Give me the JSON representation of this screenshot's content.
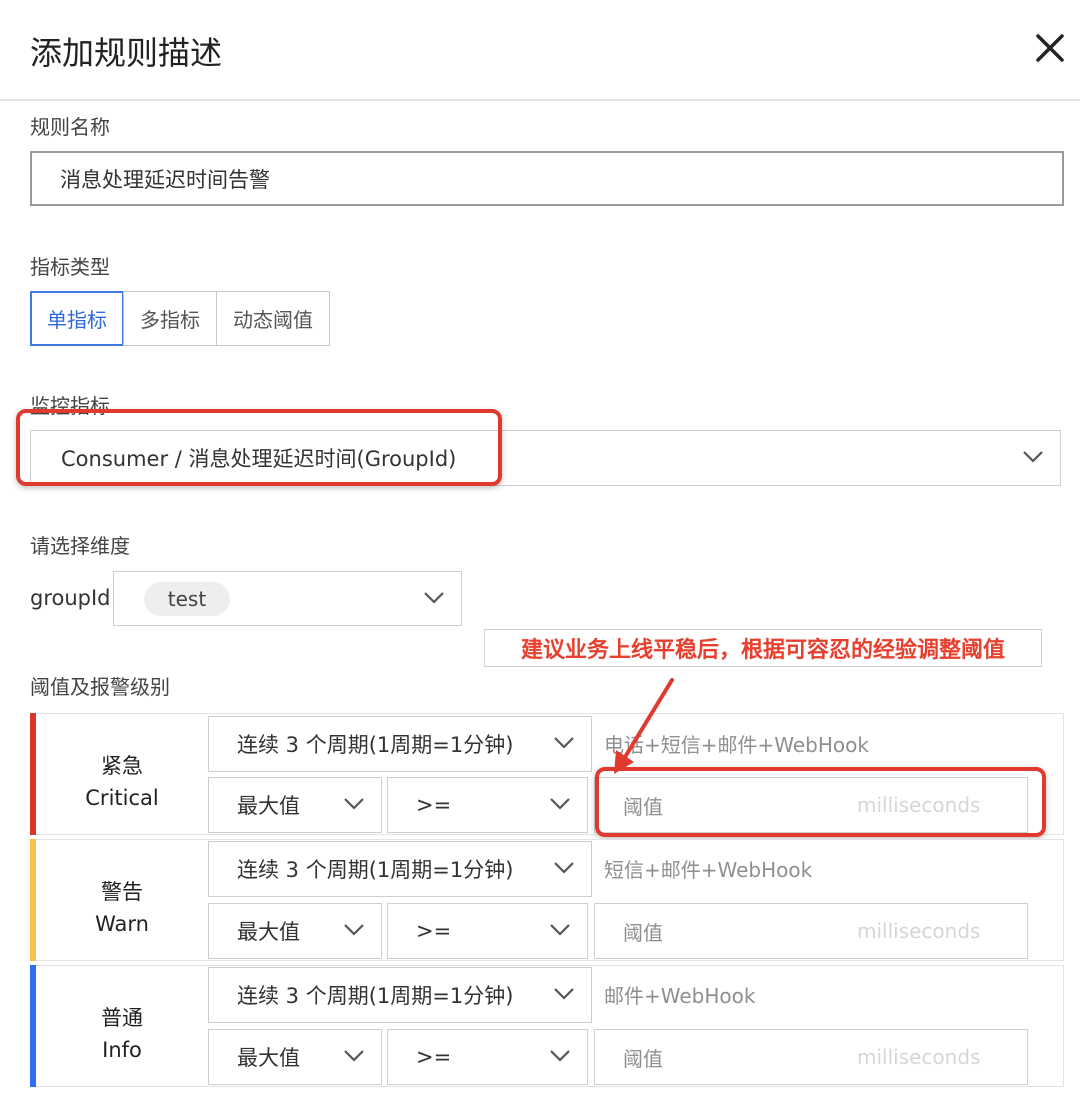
{
  "dialog": {
    "title": "添加规则描述"
  },
  "rule_name": {
    "label": "规则名称",
    "value": "消息处理延迟时间告警"
  },
  "metric_type": {
    "label": "指标类型",
    "options": [
      "单指标",
      "多指标",
      "动态阈值"
    ],
    "selected": "单指标"
  },
  "monitor_metric": {
    "label": "监控指标",
    "value": "Consumer / 消息处理延迟时间(GroupId)"
  },
  "dimension": {
    "label": "请选择维度",
    "field_label": "groupId:",
    "tag": "test"
  },
  "threshold": {
    "label": "阈值及报警级别",
    "levels": [
      {
        "name_cn": "紧急",
        "name_en": "Critical",
        "color": "#d9362b",
        "period": "连续 3 个周期(1周期=1分钟)",
        "channels": "电话+短信+邮件+WebHook",
        "stat": "最大值",
        "op": ">=",
        "value_placeholder": "阈值",
        "unit": "milliseconds"
      },
      {
        "name_cn": "警告",
        "name_en": "Warn",
        "color": "#f7c24f",
        "period": "连续 3 个周期(1周期=1分钟)",
        "channels": "短信+邮件+WebHook",
        "stat": "最大值",
        "op": ">=",
        "value_placeholder": "阈值",
        "unit": "milliseconds"
      },
      {
        "name_cn": "普通",
        "name_en": "Info",
        "color": "#2e6ef0",
        "period": "连续 3 个周期(1周期=1分钟)",
        "channels": "邮件+WebHook",
        "stat": "最大值",
        "op": ">=",
        "value_placeholder": "阈值",
        "unit": "milliseconds"
      }
    ]
  },
  "annotation": {
    "text": "建议业务上线平稳后，根据可容忍的经验调整阈值",
    "color": "#e0392f"
  },
  "icons": {
    "close": "close-icon",
    "chevron": "chevron-down-icon",
    "arrow": "annotation-arrow"
  }
}
